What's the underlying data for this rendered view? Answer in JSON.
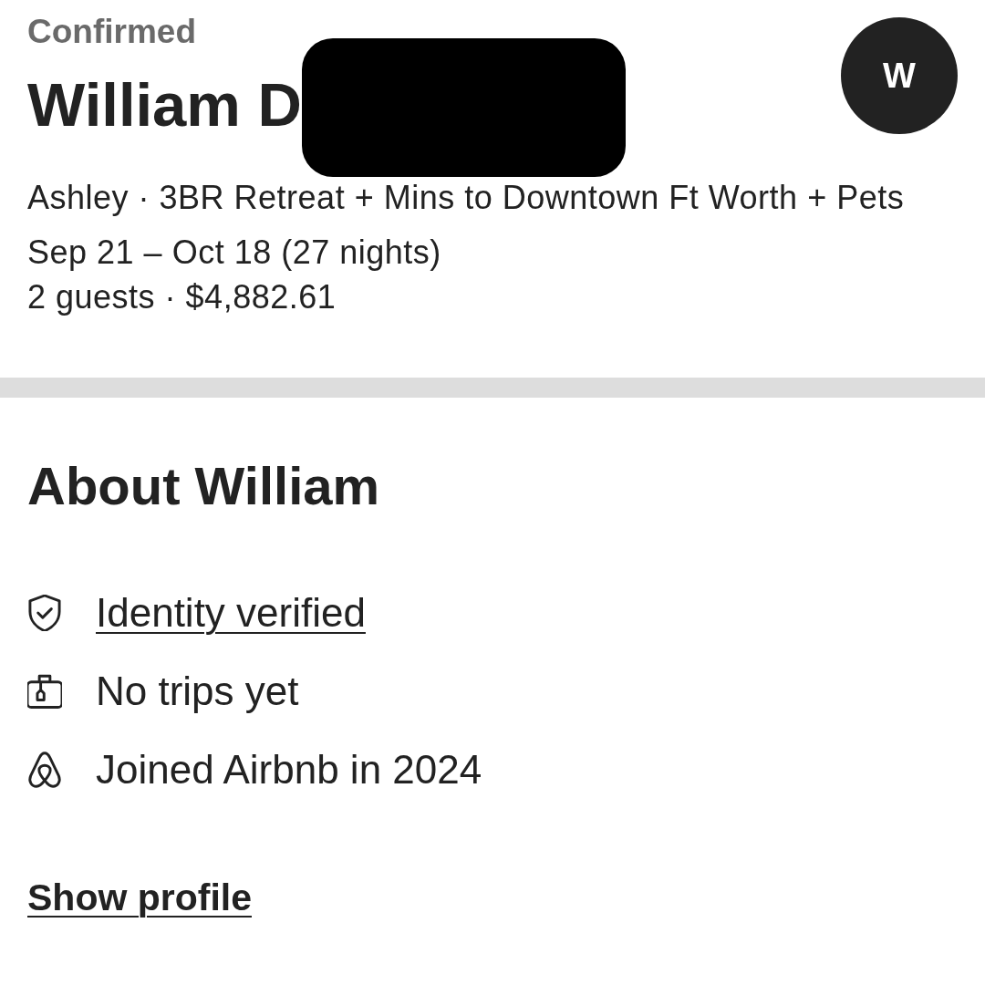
{
  "reservation": {
    "status": "Confirmed",
    "guest_name": "William D",
    "redacted": true,
    "avatar_initial": "W",
    "listing": "Ashley · 3BR Retreat + Mins to Downtown Ft Worth + Pets",
    "dates": "Sep 21 – Oct 18 (27 nights)",
    "guests_price": "2 guests · $4,882.61"
  },
  "about": {
    "title": "About William",
    "facts": [
      {
        "kind": "verified",
        "text": "Identity verified",
        "link": true
      },
      {
        "kind": "trips",
        "text": "No trips yet",
        "link": false
      },
      {
        "kind": "joined",
        "text": "Joined Airbnb in 2024",
        "link": false
      }
    ]
  },
  "show_profile": "Show profile"
}
